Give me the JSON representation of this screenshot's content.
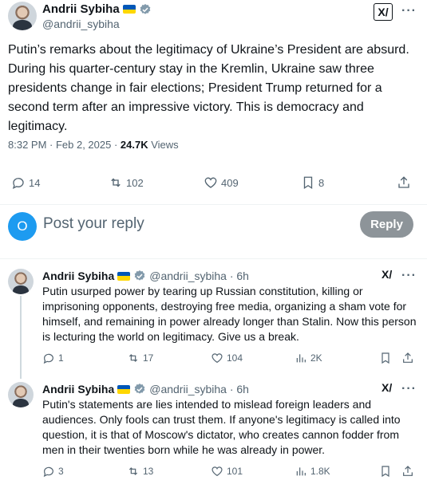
{
  "main_tweet": {
    "author_name": "Andrii Sybiha",
    "author_handle": "@andrii_sybiha",
    "text": "Putin’s remarks about the legitimacy of Ukraine’s President are absurd. During his quarter-century stay in the Kremlin, Ukraine saw three presidents change in fair elections; President Trump returned for a second term after an impressive victory. This is democracy and legitimacy.",
    "timestamp": "8:32 PM · Feb 2, 2025 · ",
    "views_count": "24.7K",
    "views_label": " Views",
    "replies": "14",
    "reposts": "102",
    "likes": "409",
    "bookmarks": "8",
    "xai_label": "X/",
    "more_label": "···"
  },
  "compose": {
    "avatar_letter": "O",
    "placeholder": "Post your reply",
    "reply_button": "Reply"
  },
  "replies": [
    {
      "author_name": "Andrii Sybiha",
      "author_handle": "@andrii_sybiha · 6h",
      "text": "Putin usurped power by tearing up Russian constitution, killing or imprisoning opponents, destroying free media, organizing a sham vote for himself, and remaining in power already longer than Stalin. Now this person is lecturing the world on legitimacy. Give us a break.",
      "replies": "1",
      "reposts": "17",
      "likes": "104",
      "views": "2K"
    },
    {
      "author_name": "Andrii Sybiha",
      "author_handle": "@andrii_sybiha · 6h",
      "text": "Putin's statements are lies intended to mislead foreign leaders and audiences. Only fools can trust them. If anyone's legitimacy is called into question, it is that of Moscow's dictator, who creates cannon fodder from men in their twenties born while he was already in power.",
      "replies": "3",
      "reposts": "13",
      "likes": "101",
      "views": "1.8K"
    }
  ],
  "colors": {
    "accent": "#1d9bf0",
    "secondary_text": "#536471",
    "verified": "#829aab",
    "flag_blue": "#0057b7",
    "flag_yellow": "#ffd700"
  }
}
